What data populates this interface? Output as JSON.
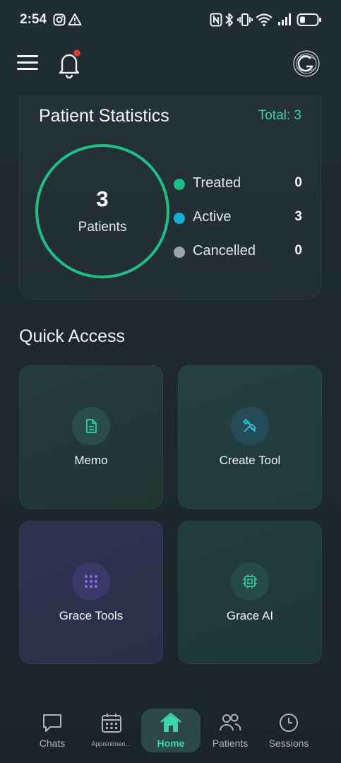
{
  "status_bar": {
    "time": "2:54",
    "battery_level": 0.3
  },
  "app_bar": {
    "notification_badge_color": "#e53935"
  },
  "stats": {
    "title": "Patient Statistics",
    "total_label": "Total: 3",
    "count": "3",
    "count_label": "Patients",
    "legend": [
      {
        "label": "Treated",
        "value": "0",
        "color": "#1fbf84"
      },
      {
        "label": "Active",
        "value": "3",
        "color": "#19aed6"
      },
      {
        "label": "Cancelled",
        "value": "0",
        "color": "#9aa3ad"
      }
    ],
    "ring_color": "#1fbf84"
  },
  "quick_access": {
    "title": "Quick Access",
    "tiles": [
      {
        "label": "Memo",
        "icon": "document-icon"
      },
      {
        "label": "Create Tool",
        "icon": "tools-icon"
      },
      {
        "label": "Grace Tools",
        "icon": "grid-dots-icon"
      },
      {
        "label": "Grace AI",
        "icon": "chip-icon"
      }
    ]
  },
  "bottom_nav": {
    "items": [
      {
        "label": "Chats",
        "icon": "chat-bubble-icon"
      },
      {
        "label": "Appointmen…",
        "icon": "calendar-icon"
      },
      {
        "label": "Home",
        "icon": "home-icon",
        "active": true
      },
      {
        "label": "Patients",
        "icon": "users-icon"
      },
      {
        "label": "Sessions",
        "icon": "clock-icon"
      }
    ],
    "accent": "#3fd3a8"
  }
}
